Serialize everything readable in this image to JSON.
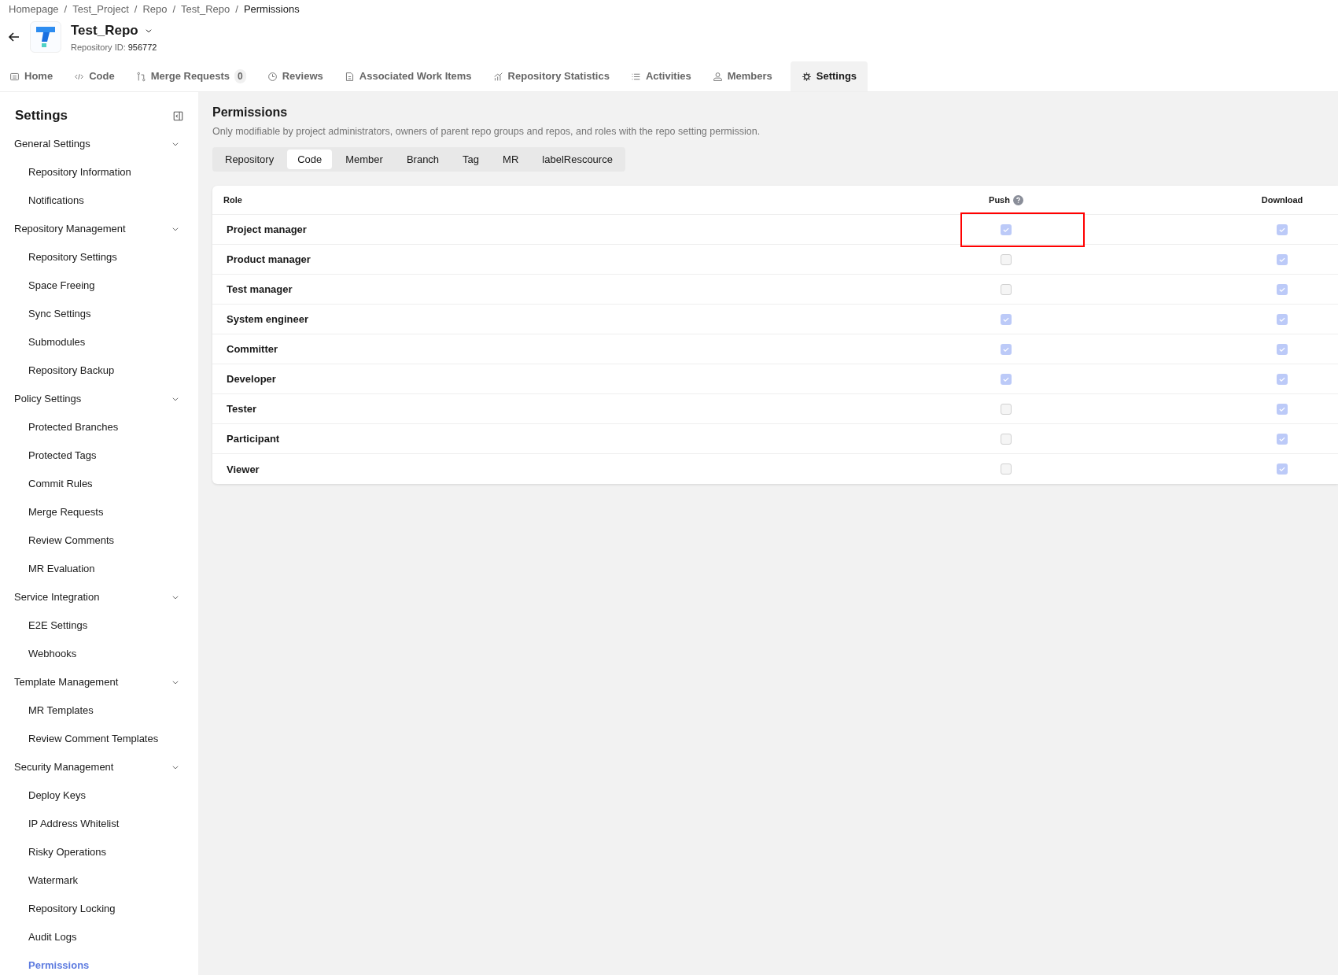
{
  "breadcrumb": {
    "separator": "/",
    "items": [
      "Homepage",
      "Test_Project",
      "Repo",
      "Test_Repo",
      "Permissions"
    ]
  },
  "repo": {
    "name": "Test_Repo",
    "id_label": "Repository ID:",
    "id": "956772"
  },
  "tabs": [
    {
      "label": "Home",
      "selected": false
    },
    {
      "label": "Code",
      "selected": false
    },
    {
      "label": "Merge Requests",
      "count": "0",
      "selected": false
    },
    {
      "label": "Reviews",
      "selected": false
    },
    {
      "label": "Associated Work Items",
      "selected": false
    },
    {
      "label": "Repository Statistics",
      "selected": false
    },
    {
      "label": "Activities",
      "selected": false
    },
    {
      "label": "Members",
      "selected": false
    },
    {
      "label": "Settings",
      "selected": true
    }
  ],
  "sidebar": {
    "title": "Settings",
    "groups": [
      {
        "label": "General Settings",
        "expanded": true,
        "children": [
          {
            "label": "Repository Information",
            "selected": false
          },
          {
            "label": "Notifications",
            "selected": false
          }
        ]
      },
      {
        "label": "Repository Management",
        "expanded": true,
        "children": [
          {
            "label": "Repository Settings",
            "selected": false
          },
          {
            "label": "Space Freeing",
            "selected": false
          },
          {
            "label": "Sync Settings",
            "selected": false
          },
          {
            "label": "Submodules",
            "selected": false
          },
          {
            "label": "Repository Backup",
            "selected": false
          }
        ]
      },
      {
        "label": "Policy Settings",
        "expanded": true,
        "children": [
          {
            "label": "Protected Branches",
            "selected": false
          },
          {
            "label": "Protected Tags",
            "selected": false
          },
          {
            "label": "Commit Rules",
            "selected": false
          },
          {
            "label": "Merge Requests",
            "selected": false
          },
          {
            "label": "Review Comments",
            "selected": false
          },
          {
            "label": "MR Evaluation",
            "selected": false
          }
        ]
      },
      {
        "label": "Service Integration",
        "expanded": true,
        "children": [
          {
            "label": "E2E Settings",
            "selected": false
          },
          {
            "label": "Webhooks",
            "selected": false
          }
        ]
      },
      {
        "label": "Template Management",
        "expanded": true,
        "children": [
          {
            "label": "MR Templates",
            "selected": false
          },
          {
            "label": "Review Comment Templates",
            "selected": false
          }
        ]
      },
      {
        "label": "Security Management",
        "expanded": true,
        "children": [
          {
            "label": "Deploy Keys",
            "selected": false
          },
          {
            "label": "IP Address Whitelist",
            "selected": false
          },
          {
            "label": "Risky Operations",
            "selected": false
          },
          {
            "label": "Watermark",
            "selected": false
          },
          {
            "label": "Repository Locking",
            "selected": false
          },
          {
            "label": "Audit Logs",
            "selected": false
          },
          {
            "label": "Permissions",
            "selected": true
          }
        ]
      }
    ]
  },
  "page": {
    "title": "Permissions",
    "description": "Only modifiable by project administrators, owners of parent repo groups and repos, and roles with the repo setting permission."
  },
  "subtabs": [
    {
      "label": "Repository",
      "selected": false
    },
    {
      "label": "Code",
      "selected": true
    },
    {
      "label": "Member",
      "selected": false
    },
    {
      "label": "Branch",
      "selected": false
    },
    {
      "label": "Tag",
      "selected": false
    },
    {
      "label": "MR",
      "selected": false
    },
    {
      "label": "labelRescource",
      "selected": false
    }
  ],
  "table": {
    "columns": [
      "Role",
      "Push",
      "Download"
    ],
    "rows": [
      {
        "role": "Project manager",
        "push": true,
        "download": true,
        "highlighted": true
      },
      {
        "role": "Product manager",
        "push": false,
        "download": true,
        "highlighted": false
      },
      {
        "role": "Test manager",
        "push": false,
        "download": true,
        "highlighted": false
      },
      {
        "role": "System engineer",
        "push": true,
        "download": true,
        "highlighted": false
      },
      {
        "role": "Committer",
        "push": true,
        "download": true,
        "highlighted": false
      },
      {
        "role": "Developer",
        "push": true,
        "download": true,
        "highlighted": false
      },
      {
        "role": "Tester",
        "push": false,
        "download": true,
        "highlighted": false
      },
      {
        "role": "Participant",
        "push": false,
        "download": true,
        "highlighted": false
      },
      {
        "role": "Viewer",
        "push": false,
        "download": true,
        "highlighted": false
      }
    ]
  }
}
